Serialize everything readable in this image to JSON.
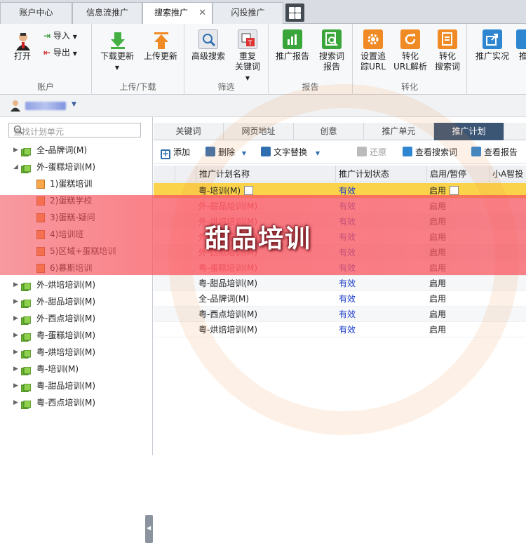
{
  "tabs": [
    "账户中心",
    "信息流推广",
    "搜索推广",
    "闪投推广"
  ],
  "ribbon": {
    "account": {
      "open": "打开",
      "import": "导入",
      "export": "导出",
      "label": "账户"
    },
    "updown": {
      "download": "下载更新",
      "upload": "上传更新",
      "label": "上传/下载"
    },
    "filter": {
      "advanced": "高级搜索",
      "dup1": "重复",
      "dup2": "关键词",
      "label": "筛选"
    },
    "report": {
      "promo": "推广报告",
      "search1": "搜索词",
      "search2": "报告",
      "label": "报告"
    },
    "convert": {
      "track1": "设置追",
      "track2": "踪URL",
      "url1": "转化",
      "url2": "URL解析",
      "word1": "转化",
      "word2": "搜索词",
      "label": "转化"
    },
    "live": {
      "live": "推广实况",
      "more": "推"
    }
  },
  "account_name": "",
  "search_placeholder": "查找计划单元",
  "tree": [
    {
      "label": "全-品牌词(M)"
    },
    {
      "label": "外-蛋糕培训(M)"
    },
    {
      "label": "1)蛋糕培训"
    },
    {
      "label": "2)蛋糕学校"
    },
    {
      "label": "3)蛋糕-疑问"
    },
    {
      "label": "4)培训班"
    },
    {
      "label": "5)区域+蛋糕培训"
    },
    {
      "label": "6)慕斯培训"
    },
    {
      "label": "外-烘培培训(M)"
    },
    {
      "label": "外-甜品培训(M)"
    },
    {
      "label": "外-西点培训(M)"
    },
    {
      "label": "粤-蛋糕培训(M)"
    },
    {
      "label": "粤-烘培培训(M)"
    },
    {
      "label": "粤-培训(M)"
    },
    {
      "label": "粤-甜品培训(M)"
    },
    {
      "label": "粤-西点培训(M)"
    }
  ],
  "right_tabs": [
    "关键词",
    "网页地址",
    "创意",
    "推广单元",
    "推广计划"
  ],
  "toolbar": {
    "add": "添加",
    "delete": "删除",
    "replace": "文字替换",
    "restore": "还原",
    "view_search": "查看搜索词",
    "view_report": "查看报告"
  },
  "columns": [
    "推广计划名称",
    "推广计划状态",
    "启用/暂停",
    "小A智投"
  ],
  "rows": [
    {
      "name": "粤-培训(M)",
      "status": "有效",
      "state": "启用"
    },
    {
      "name": "外-甜品培训(M)",
      "status": "有效",
      "state": "启用"
    },
    {
      "name": "外-烘培培训(M)",
      "status": "有效",
      "state": "启用"
    },
    {
      "name": "外-蛋糕培训(M)",
      "status": "有效",
      "state": "启用"
    },
    {
      "name": "外-西点培训(M)",
      "status": "有效",
      "state": "启用"
    },
    {
      "name": "粤-蛋糕培训(M)",
      "status": "有效",
      "state": "启用"
    },
    {
      "name": "粤-甜品培训(M)",
      "status": "有效",
      "state": "启用"
    },
    {
      "name": "全-品牌词(M)",
      "status": "有效",
      "state": "启用"
    },
    {
      "name": "粤-西点培训(M)",
      "status": "有效",
      "state": "启用"
    },
    {
      "name": "粤-烘焙培训(M)",
      "status": "有效",
      "state": "启用"
    }
  ],
  "banner": "甜品培训",
  "colors": {
    "selected_row": "#fbd34a",
    "active_tab": "#3b5675",
    "status_blue": "#1a3cc8",
    "banner": "#f0505a"
  }
}
